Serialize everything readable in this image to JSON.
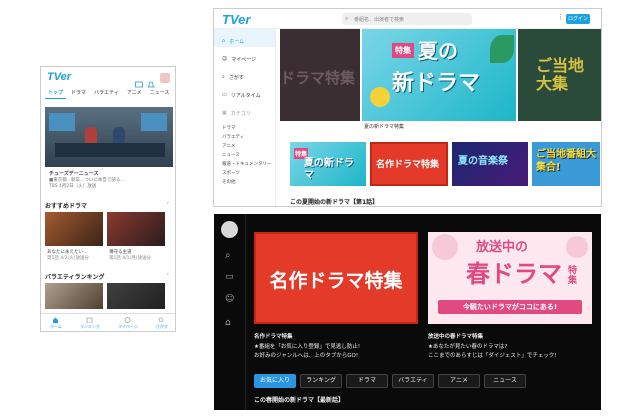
{
  "phone": {
    "logo": "TVer",
    "tabs": [
      "トップ",
      "ドラマ",
      "バラエティ",
      "アニメ",
      "ニュース"
    ],
    "hero_title": "チューズデーニュース",
    "hero_sub1": "■東京都...新卒...ついに本音で語る...",
    "hero_sub2": "TBS  4月2日（火）放送",
    "sec1": "おすすめドラマ",
    "items": [
      {
        "title": "あなたに永えたい...",
        "meta": "第1話  4/2(火)放送分"
      },
      {
        "title": "薄守る主道",
        "meta": "第1話  4/1(月)放送分"
      }
    ],
    "sec2": "バラエティランキング",
    "nav": [
      "ホーム",
      "ランキング",
      "マイページ",
      "さがす"
    ]
  },
  "desk": {
    "logo": "TVer",
    "search_placeholder": "番組名、出演者で検索",
    "login": "ログイン",
    "side_items": [
      {
        "label": "ホーム",
        "on": true
      },
      {
        "label": "マイページ",
        "on": false
      },
      {
        "label": "さがす",
        "on": false
      },
      {
        "label": "リアルタイム",
        "on": false
      },
      {
        "label": "カテゴリ",
        "on": false
      }
    ],
    "side_sub": [
      "ドラマ",
      "バラエティ",
      "アニメ",
      "ニュース",
      "報道・ドキュメンタリー",
      "スポーツ",
      "その他"
    ],
    "banner_left": "ドラマ特集",
    "banner_tag": "特集",
    "banner_line1": "夏の",
    "banner_line2": "新ドラマ",
    "banner_caption": "夏の新ドラマ特集",
    "banner_right": "ご当地大集",
    "thumbs": [
      {
        "top": "特集",
        "text": "夏の新ドラマ"
      },
      {
        "text": "名作ドラマ特集"
      },
      {
        "text": "夏の音楽祭"
      },
      {
        "text": "ご当地番組大集合!"
      }
    ],
    "row_title": "この夏開始の新ドラマ【第1話】"
  },
  "dark": {
    "card1_text": "名作ドラマ特集",
    "card2_l1": "放送中の",
    "card2_l2": "春ドラマ",
    "card2_tag": "特集",
    "card2_bar": "今観たいドラマがココにある!",
    "c1_title": "名作ドラマ特集",
    "c1_d1": "★番組を「お気に入り登録」で見逃し防止!",
    "c1_d2": "お好みのジャンルへは、上のタブからGO!",
    "c2_title": "放送中の春ドラマ特集",
    "c2_d1": "★あなたが見たい春のドラマは?",
    "c2_d2": "ここまでのあらすじは「ダイジェスト」でチェック!",
    "chips": [
      "お気に入り",
      "ランキング",
      "ドラマ",
      "バラエティ",
      "アニメ",
      "ニュース"
    ],
    "row_title": "この春開始の新ドラマ【最新話】"
  },
  "colors": {
    "accent": "#1da0e0",
    "red": "#e33a2a",
    "pink": "#e04a80"
  }
}
